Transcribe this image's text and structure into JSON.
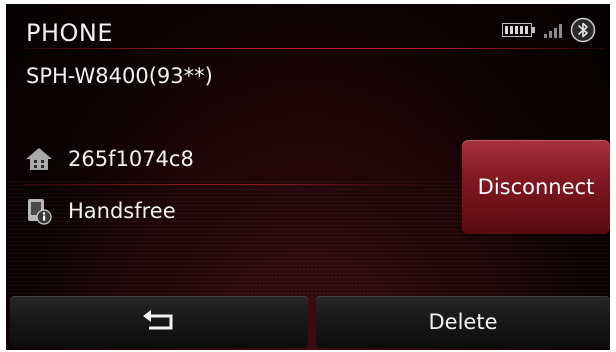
{
  "header": {
    "title": "PHONE",
    "status_icons": [
      "battery-icon",
      "signal-icon",
      "bluetooth-icon"
    ]
  },
  "device": {
    "name": "SPH-W8400(93**)",
    "id": "265f1074c8",
    "id_icon": "home-icon",
    "profile": "Handsfree",
    "profile_icon": "handsfree-info-icon"
  },
  "actions": {
    "disconnect_label": "Disconnect",
    "back_icon": "back-arrow-icon",
    "delete_label": "Delete"
  },
  "colors": {
    "accent": "#b4182a",
    "button_red": "#7f1620",
    "text": "#f2f2f2"
  }
}
